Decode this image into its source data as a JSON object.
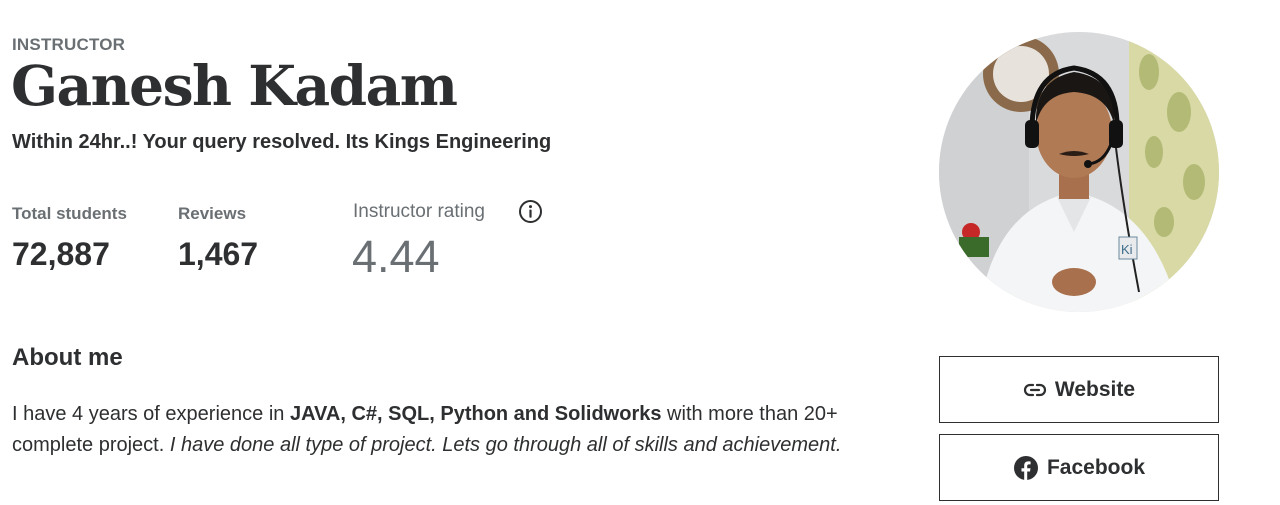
{
  "profile": {
    "role_label": "INSTRUCTOR",
    "name": "Ganesh Kadam",
    "headline": "Within 24hr..! Your query resolved. Its Kings Engineering"
  },
  "stats": {
    "students_label": "Total students",
    "students_value": "72,887",
    "reviews_label": "Reviews",
    "reviews_value": "1,467",
    "rating_label": "Instructor rating",
    "rating_value": "4.44"
  },
  "about": {
    "title": "About me",
    "text_1": "I have 4 years of experience in ",
    "text_bold": "JAVA, C#, SQL, Python and Solidworks",
    "text_2": "  with more than 20+ complete project. ",
    "text_italic": "I have done all type of  project. Lets go through all of skills and achievement."
  },
  "links": {
    "website_label": "Website",
    "facebook_label": "Facebook"
  },
  "icons": {
    "info": "info-icon",
    "link": "link-icon",
    "facebook": "facebook-icon"
  },
  "avatar": {
    "badge_text": "Ki"
  },
  "colors": {
    "text_primary": "#2d2f31",
    "text_secondary": "#6a6f73",
    "border": "#2d2f31"
  }
}
